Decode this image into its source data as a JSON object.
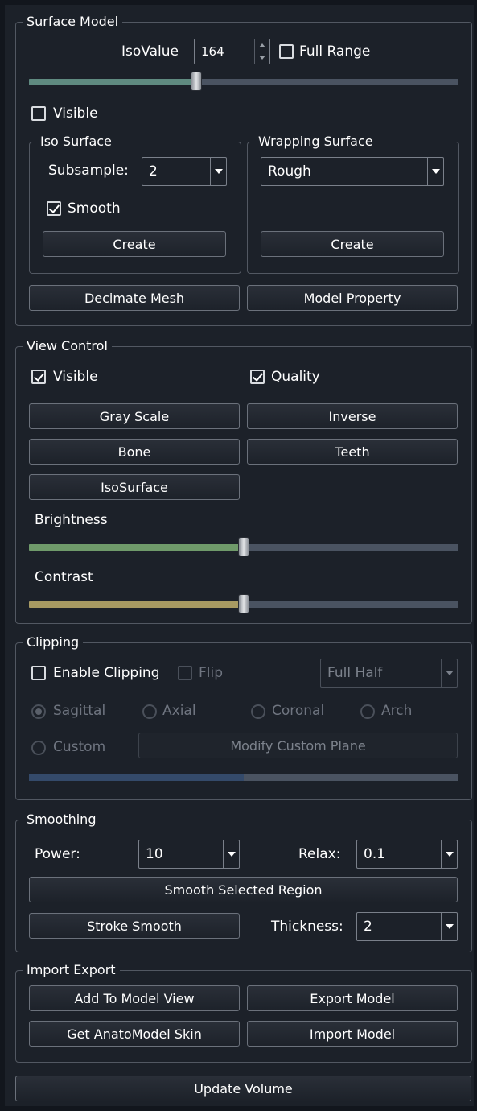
{
  "surface_model": {
    "title": "Surface Model",
    "isovalue_label": "IsoValue",
    "isovalue": "164",
    "full_range_label": "Full Range",
    "full_range_checked": false,
    "iso_slider_level": 0.39,
    "visible_label": "Visible",
    "visible_checked": false,
    "iso_surface": {
      "title": "Iso Surface",
      "subsample_label": "Subsample:",
      "subsample_value": "2",
      "smooth_label": "Smooth",
      "smooth_checked": true,
      "create_label": "Create"
    },
    "wrapping_surface": {
      "title": "Wrapping Surface",
      "mode_value": "Rough",
      "create_label": "Create"
    },
    "decimate_label": "Decimate Mesh",
    "model_property_label": "Model Property"
  },
  "view_control": {
    "title": "View Control",
    "visible_label": "Visible",
    "visible_checked": true,
    "quality_label": "Quality",
    "quality_checked": true,
    "gray_scale_label": "Gray Scale",
    "inverse_label": "Inverse",
    "bone_label": "Bone",
    "teeth_label": "Teeth",
    "isosurface_label": "IsoSurface",
    "brightness_label": "Brightness",
    "brightness_level": 0.5,
    "contrast_label": "Contrast",
    "contrast_level": 0.5,
    "colors": {
      "brightness_fill": "#6f9a6a",
      "contrast_fill": "#a79a62",
      "track": "#4a5361"
    }
  },
  "clipping": {
    "title": "Clipping",
    "enable_label": "Enable Clipping",
    "enable_checked": false,
    "flip_label": "Flip",
    "mode_value": "Full Half",
    "radios": [
      {
        "label": "Sagittal",
        "selected": true
      },
      {
        "label": "Axial",
        "selected": false
      },
      {
        "label": "Coronal",
        "selected": false
      },
      {
        "label": "Arch",
        "selected": false
      }
    ],
    "custom_label": "Custom",
    "modify_plane_label": "Modify Custom Plane",
    "plane_level": 0.5
  },
  "smoothing": {
    "title": "Smoothing",
    "power_label": "Power:",
    "power_value": "10",
    "relax_label": "Relax:",
    "relax_value": "0.1",
    "smooth_region_label": "Smooth Selected Region",
    "stroke_smooth_label": "Stroke Smooth",
    "thickness_label": "Thickness:",
    "thickness_value": "2"
  },
  "import_export": {
    "title": "Import Export",
    "add_to_view_label": "Add To Model View",
    "export_label": "Export Model",
    "get_skin_label": "Get AnatoModel Skin",
    "import_label": "Import Model"
  },
  "update_volume_label": "Update Volume"
}
